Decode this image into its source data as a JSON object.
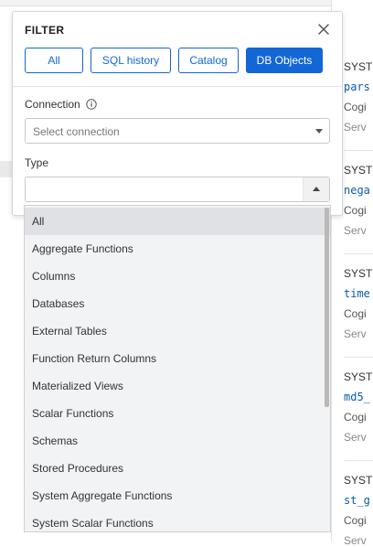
{
  "filter_panel": {
    "title": "FILTER",
    "tabs": [
      {
        "label": "All",
        "active": false
      },
      {
        "label": "SQL history",
        "active": false
      },
      {
        "label": "Catalog",
        "active": false
      },
      {
        "label": "DB Objects",
        "active": true
      }
    ],
    "connection": {
      "label": "Connection",
      "placeholder": "Select connection",
      "icon": "info-icon"
    },
    "type": {
      "label": "Type",
      "value": ""
    }
  },
  "type_dropdown": {
    "highlighted": "All",
    "options": [
      "All",
      "Aggregate Functions",
      "Columns",
      "Databases",
      "External Tables",
      "Function Return Columns",
      "Materialized Views",
      "Scalar Functions",
      "Schemas",
      "Stored Procedures",
      "System Aggregate Functions",
      "System Scalar Functions"
    ]
  },
  "results": [
    {
      "line1": "SYST",
      "line2": "pars",
      "line3": "Cogi",
      "line4": "Serv"
    },
    {
      "line1": "SYST",
      "line2": "nega",
      "line3": "Cogi",
      "line4": "Serv"
    },
    {
      "line1": "SYST",
      "line2": "time",
      "line3": "Cogi",
      "line4": "Serv"
    },
    {
      "line1": "SYST",
      "line2": "md5_",
      "line3": "Cogi",
      "line4": "Serv"
    },
    {
      "line1": "SYST",
      "line2": "st_g",
      "line3": "Cogi",
      "line4": "Serv"
    }
  ],
  "colors": {
    "accent": "#1366d6",
    "highlight": "#e0e1e4",
    "dropdown_bg": "#f2f3f5"
  }
}
